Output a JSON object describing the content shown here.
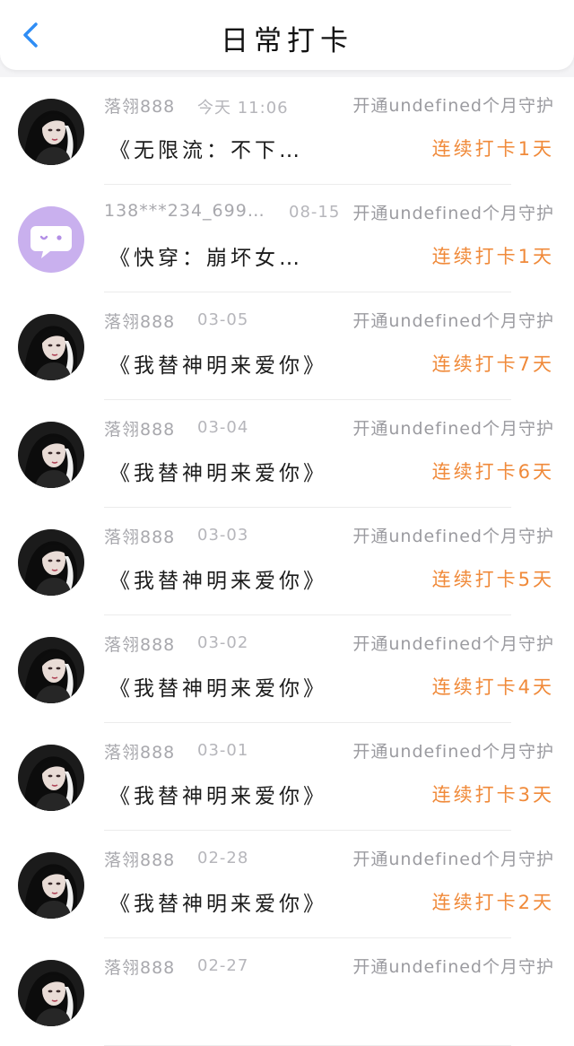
{
  "header": {
    "title": "日常打卡",
    "back_icon": "chevron-left-icon"
  },
  "colors": {
    "accent_blue": "#2f8df5",
    "streak_orange": "#f08a3a",
    "meta_gray": "#a8a8ad"
  },
  "entries": [
    {
      "user": "落翎888",
      "time": "今天 11:06",
      "guard": "开通undefined个月守护",
      "book": "《无限流：不下…",
      "streak": "连续打卡1天",
      "avatar": "portrait-avatar"
    },
    {
      "user": "138***234_699…",
      "time": "08-15",
      "guard": "开通undefined个月守护",
      "book": "《快穿：崩坏女…",
      "streak": "连续打卡1天",
      "avatar": "default-chat-avatar"
    },
    {
      "user": "落翎888",
      "time": "03-05",
      "guard": "开通undefined个月守护",
      "book": "《我替神明来爱你》",
      "streak": "连续打卡7天",
      "avatar": "portrait-avatar"
    },
    {
      "user": "落翎888",
      "time": "03-04",
      "guard": "开通undefined个月守护",
      "book": "《我替神明来爱你》",
      "streak": "连续打卡6天",
      "avatar": "portrait-avatar"
    },
    {
      "user": "落翎888",
      "time": "03-03",
      "guard": "开通undefined个月守护",
      "book": "《我替神明来爱你》",
      "streak": "连续打卡5天",
      "avatar": "portrait-avatar"
    },
    {
      "user": "落翎888",
      "time": "03-02",
      "guard": "开通undefined个月守护",
      "book": "《我替神明来爱你》",
      "streak": "连续打卡4天",
      "avatar": "portrait-avatar"
    },
    {
      "user": "落翎888",
      "time": "03-01",
      "guard": "开通undefined个月守护",
      "book": "《我替神明来爱你》",
      "streak": "连续打卡3天",
      "avatar": "portrait-avatar"
    },
    {
      "user": "落翎888",
      "time": "02-28",
      "guard": "开通undefined个月守护",
      "book": "《我替神明来爱你》",
      "streak": "连续打卡2天",
      "avatar": "portrait-avatar"
    },
    {
      "user": "落翎888",
      "time": "02-27",
      "guard": "开通undefined个月守护",
      "book": "",
      "streak": "",
      "avatar": "portrait-avatar"
    }
  ]
}
